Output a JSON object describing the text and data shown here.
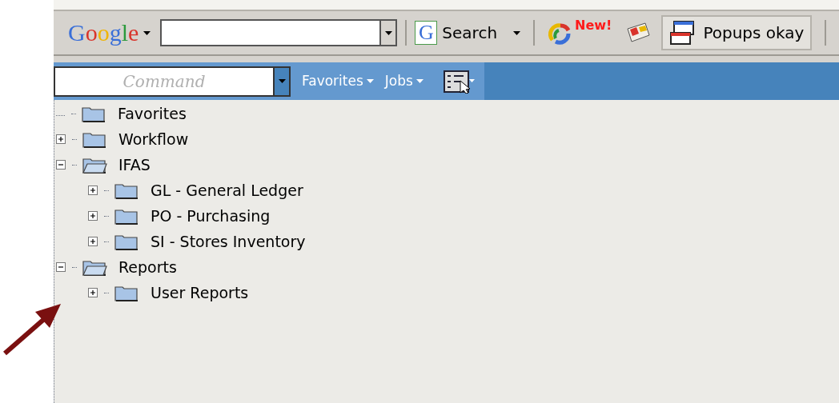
{
  "google_toolbar": {
    "logo": "Google",
    "search_icon": "G",
    "search_button": "Search",
    "new_badge": "New!",
    "popups_button": "Popups okay"
  },
  "command_bar": {
    "command_field": {
      "placeholder": "Command"
    },
    "menus": [
      "Favorites",
      "Jobs"
    ]
  },
  "tree": [
    {
      "label": "Favorites",
      "kind": "leaf"
    },
    {
      "label": "Workflow",
      "kind": "branch",
      "expanded": false
    },
    {
      "label": "IFAS",
      "kind": "branch",
      "expanded": true,
      "children": [
        {
          "label": "GL - General Ledger",
          "kind": "branch",
          "expanded": false
        },
        {
          "label": "PO - Purchasing",
          "kind": "branch",
          "expanded": false
        },
        {
          "label": "SI - Stores Inventory",
          "kind": "branch",
          "expanded": false
        }
      ]
    },
    {
      "label": "Reports",
      "kind": "branch",
      "expanded": true,
      "children": [
        {
          "label": "User Reports",
          "kind": "branch",
          "expanded": false
        }
      ]
    }
  ]
}
